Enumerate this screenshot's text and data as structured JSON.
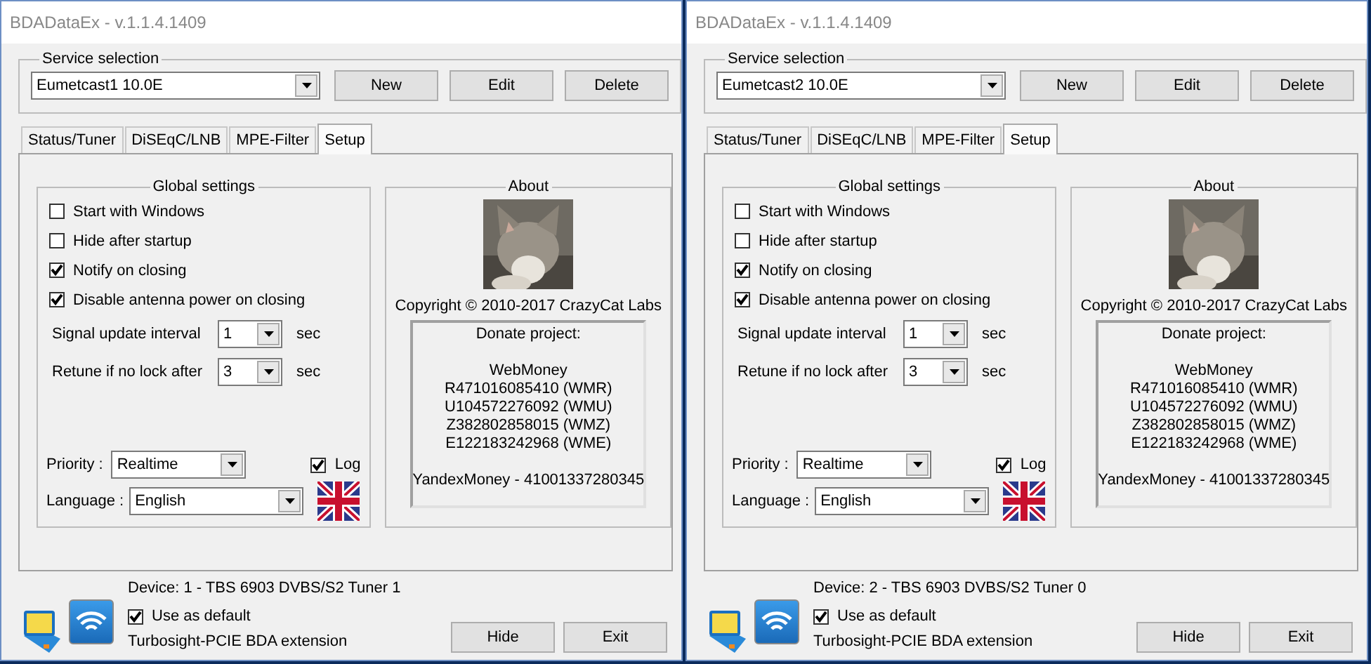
{
  "windows": [
    {
      "title": "BDADataEx - v.1.1.4.1409",
      "service_selection": {
        "label": "Service selection",
        "value": "Eumetcast1 10.0E",
        "buttons": [
          "New",
          "Edit",
          "Delete"
        ]
      },
      "tabs": [
        {
          "label": "Status/Tuner",
          "selected": false
        },
        {
          "label": "DiSEqC/LNB",
          "selected": false
        },
        {
          "label": "MPE-Filter",
          "selected": false
        },
        {
          "label": "Setup",
          "selected": true
        }
      ],
      "global_settings": {
        "title": "Global settings",
        "checkboxes": [
          {
            "label": "Start with Windows",
            "checked": false
          },
          {
            "label": "Hide after startup",
            "checked": false
          },
          {
            "label": "Notify on closing",
            "checked": true
          },
          {
            "label": "Disable antenna power on closing",
            "checked": true
          }
        ],
        "intervals": [
          {
            "label": "Signal update interval",
            "value": "1",
            "unit": "sec"
          },
          {
            "label": "Retune if no lock after",
            "value": "3",
            "unit": "sec"
          }
        ],
        "priority": {
          "label": "Priority :",
          "value": "Realtime"
        },
        "log": {
          "label": "Log",
          "checked": true
        },
        "language": {
          "label": "Language :",
          "value": "English"
        }
      },
      "about": {
        "title": "About",
        "copyright": "Copyright © 2010-2017 CrazyCat Labs",
        "donate": {
          "title": "Donate project:",
          "blocks": [
            [
              "WebMoney",
              "R471016085410 (WMR)",
              "U104572276092 (WMU)",
              "Z382802858015 (WMZ)",
              "E122183242968 (WME)"
            ],
            [
              "YandexMoney - 41001337280345"
            ]
          ]
        }
      },
      "device": "Device: 1 - TBS 6903 DVBS/S2 Tuner 1",
      "use_as_default": {
        "label": "Use as default",
        "checked": true
      },
      "extension": "Turbosight-PCIE BDA extension",
      "buttons": [
        "Hide",
        "Exit"
      ]
    },
    {
      "title": "BDADataEx - v.1.1.4.1409",
      "service_selection": {
        "label": "Service selection",
        "value": "Eumetcast2 10.0E",
        "buttons": [
          "New",
          "Edit",
          "Delete"
        ]
      },
      "tabs": [
        {
          "label": "Status/Tuner",
          "selected": false
        },
        {
          "label": "DiSEqC/LNB",
          "selected": false
        },
        {
          "label": "MPE-Filter",
          "selected": false
        },
        {
          "label": "Setup",
          "selected": true
        }
      ],
      "global_settings": {
        "title": "Global settings",
        "checkboxes": [
          {
            "label": "Start with Windows",
            "checked": false
          },
          {
            "label": "Hide after startup",
            "checked": false
          },
          {
            "label": "Notify on closing",
            "checked": true
          },
          {
            "label": "Disable antenna power on closing",
            "checked": true
          }
        ],
        "intervals": [
          {
            "label": "Signal update interval",
            "value": "1",
            "unit": "sec"
          },
          {
            "label": "Retune if no lock after",
            "value": "3",
            "unit": "sec"
          }
        ],
        "priority": {
          "label": "Priority :",
          "value": "Realtime"
        },
        "log": {
          "label": "Log",
          "checked": true
        },
        "language": {
          "label": "Language :",
          "value": "English"
        }
      },
      "about": {
        "title": "About",
        "copyright": "Copyright © 2010-2017 CrazyCat Labs",
        "donate": {
          "title": "Donate project:",
          "blocks": [
            [
              "WebMoney",
              "R471016085410 (WMR)",
              "U104572276092 (WMU)",
              "Z382802858015 (WMZ)",
              "E122183242968 (WME)"
            ],
            [
              "YandexMoney - 41001337280345"
            ]
          ]
        }
      },
      "device": "Device: 2 - TBS 6903 DVBS/S2 Tuner 0",
      "use_as_default": {
        "label": "Use as default",
        "checked": true
      },
      "extension": "Turbosight-PCIE BDA extension",
      "buttons": [
        "Hide",
        "Exit"
      ]
    }
  ]
}
